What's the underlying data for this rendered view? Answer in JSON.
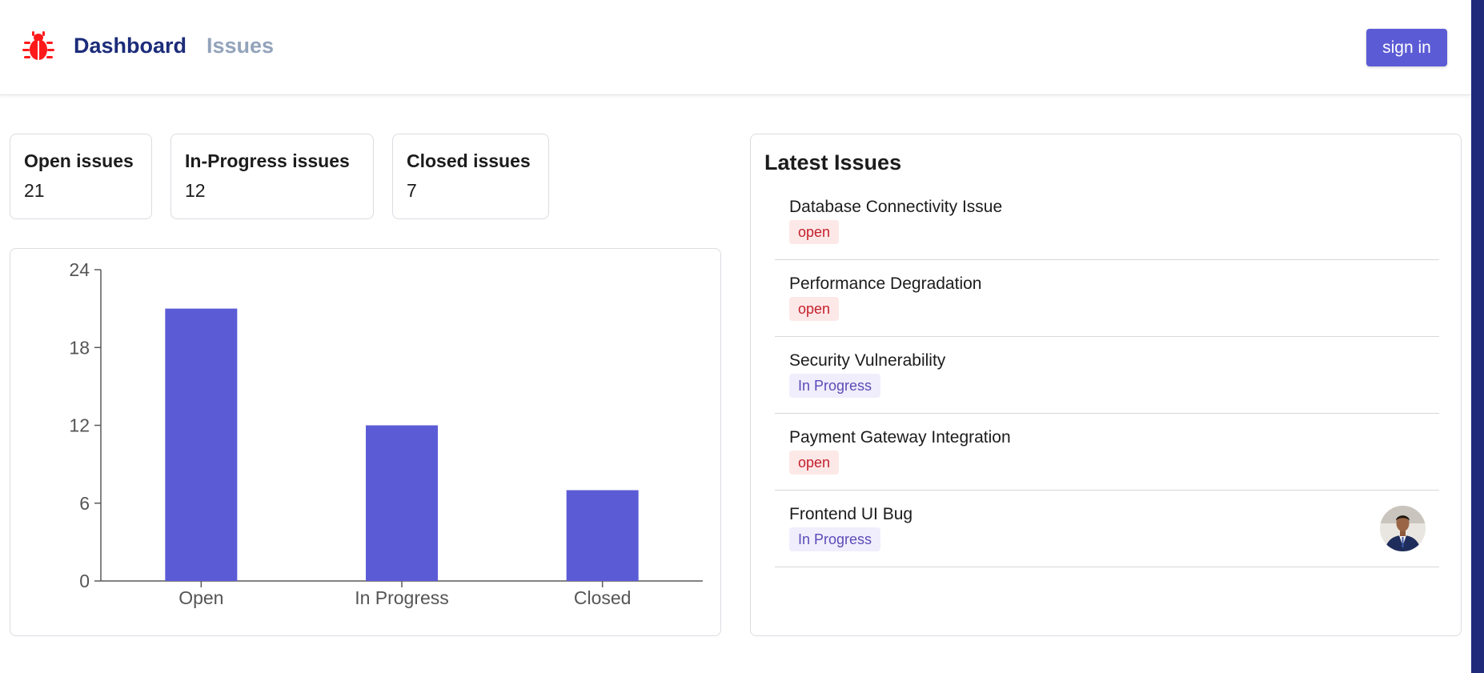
{
  "nav": {
    "logo_icon": "bug-icon",
    "dashboard_label": "Dashboard",
    "issues_label": "Issues",
    "signin_label": "sign in"
  },
  "summary": [
    {
      "label": "Open issues",
      "value": "21"
    },
    {
      "label": "In-Progress issues",
      "value": "12"
    },
    {
      "label": "Closed issues",
      "value": "7"
    }
  ],
  "chart_data": {
    "type": "bar",
    "categories": [
      "Open",
      "In Progress",
      "Closed"
    ],
    "values": [
      21,
      12,
      7
    ],
    "ylim": [
      0,
      24
    ],
    "yticks": [
      "0",
      "6",
      "12",
      "18",
      "24"
    ],
    "color": "#5c5bd6"
  },
  "latest": {
    "title": "Latest Issues",
    "issues": [
      {
        "title": "Database Connectivity Issue",
        "status": "open"
      },
      {
        "title": "Performance Degradation",
        "status": "open"
      },
      {
        "title": "Security Vulnerability",
        "status": "In Progress"
      },
      {
        "title": "Payment Gateway Integration",
        "status": "open"
      },
      {
        "title": "Frontend UI Bug",
        "status": "In Progress"
      }
    ]
  },
  "colors": {
    "accent": "#5c5bd6",
    "nav_active": "#1c2c7a",
    "nav_inactive": "#93a3bb",
    "logo": "#ff1a1a"
  }
}
